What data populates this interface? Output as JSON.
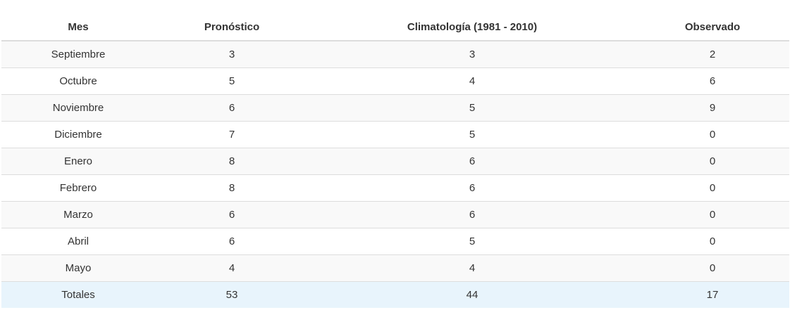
{
  "table": {
    "headers": [
      "Mes",
      "Pronóstico",
      "Climatología (1981 - 2010)",
      "Observado"
    ],
    "rows": [
      [
        "Septiembre",
        "3",
        "3",
        "2"
      ],
      [
        "Octubre",
        "5",
        "4",
        "6"
      ],
      [
        "Noviembre",
        "6",
        "5",
        "9"
      ],
      [
        "Diciembre",
        "7",
        "5",
        "0"
      ],
      [
        "Enero",
        "8",
        "6",
        "0"
      ],
      [
        "Febrero",
        "8",
        "6",
        "0"
      ],
      [
        "Marzo",
        "6",
        "6",
        "0"
      ],
      [
        "Abril",
        "6",
        "5",
        "0"
      ],
      [
        "Mayo",
        "4",
        "4",
        "0"
      ]
    ],
    "totals": [
      "Totales",
      "53",
      "44",
      "17"
    ]
  }
}
